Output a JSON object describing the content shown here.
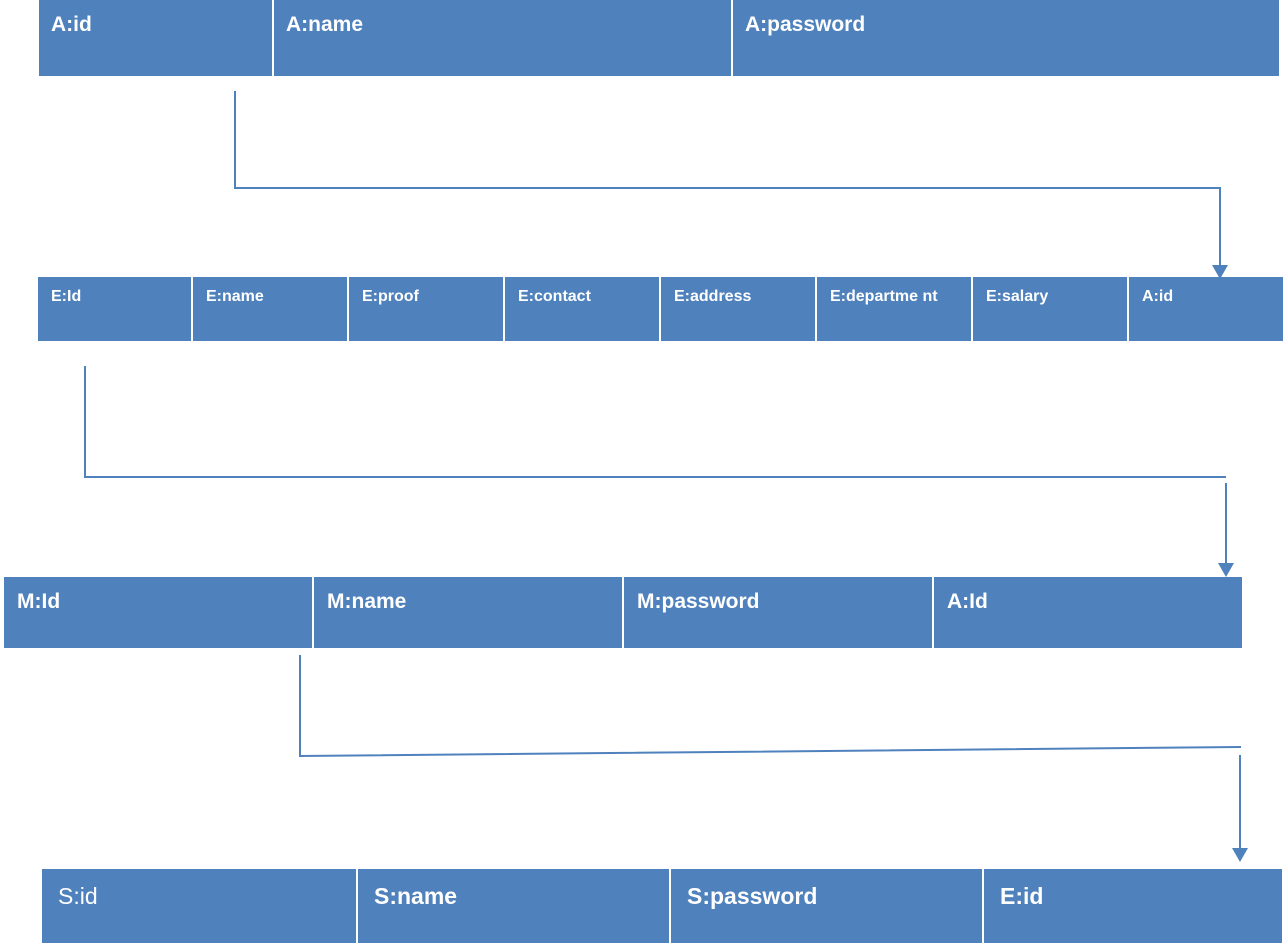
{
  "colors": {
    "cell_fill": "#4f81bd",
    "connector": "#4f81bd",
    "text": "#ffffff"
  },
  "tables": {
    "admin": [
      "A:id",
      "A:name",
      "A:password"
    ],
    "employee": [
      "E:Id",
      "E:name",
      "E:proof",
      "E:contact",
      "E:address",
      "E:departme nt",
      "E:salary",
      "A:id"
    ],
    "manager": [
      "M:Id",
      "M:name",
      "M:password",
      "A:Id"
    ],
    "staff": [
      "S:id",
      "S:name",
      "S:password",
      "E:id"
    ]
  },
  "connector_icon": "arrow-down-icon"
}
